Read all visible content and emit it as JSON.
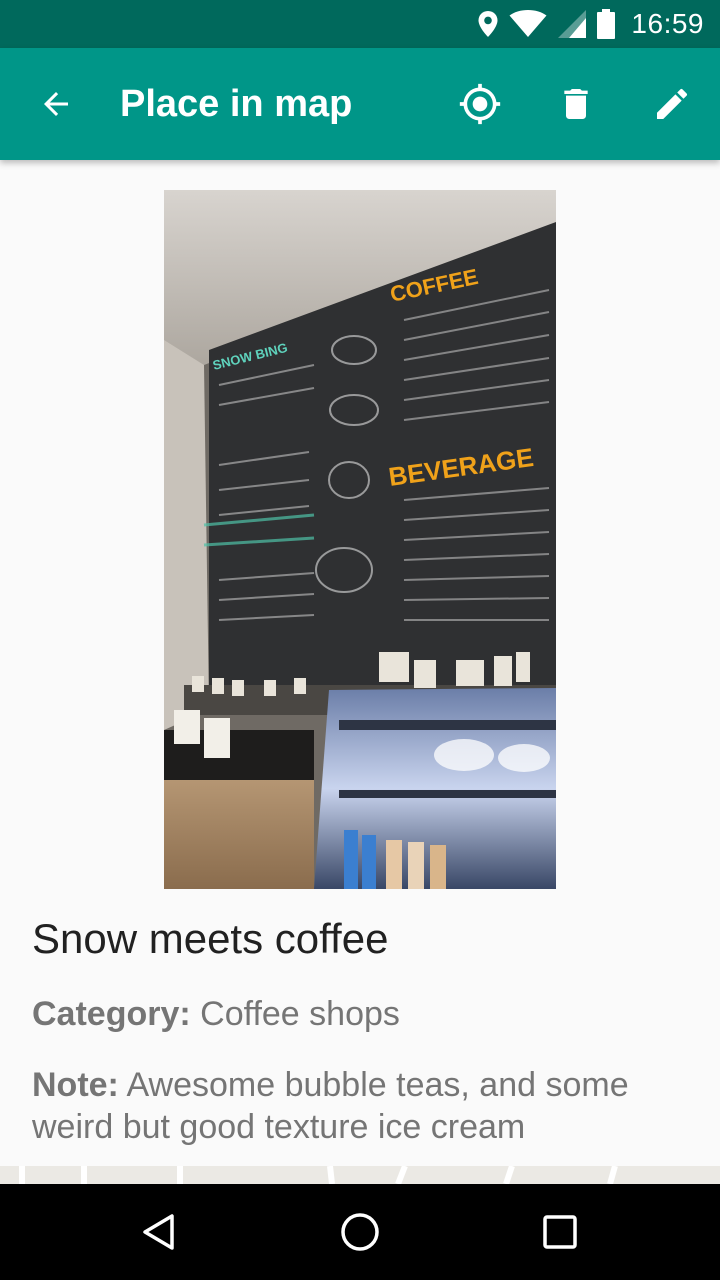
{
  "status_bar": {
    "time": "16:59",
    "icons": [
      "location-icon",
      "wifi-icon",
      "signal-icon",
      "battery-icon"
    ]
  },
  "app_bar": {
    "title": "Place in map",
    "icons": [
      "back-arrow-icon",
      "my-location-icon",
      "delete-icon",
      "edit-icon"
    ]
  },
  "place": {
    "photo_text": {
      "board_left": "SNOW BING",
      "board_top": "COFFEE",
      "board_mid": "BEVERAGE"
    },
    "name": "Snow meets coffee",
    "category_label": "Category:",
    "category_value": "Coffee shops",
    "note_label": "Note:",
    "note_value": "Awesome bubble teas, and some weird but good texture ice cream"
  },
  "nav_bar": {
    "icons": [
      "nav-back-icon",
      "nav-home-icon",
      "nav-recents-icon"
    ]
  },
  "colors": {
    "status_bar": "#00695c",
    "app_bar": "#009688",
    "background": "#fafafa",
    "title_text": "#212121",
    "secondary_text": "#757575"
  }
}
